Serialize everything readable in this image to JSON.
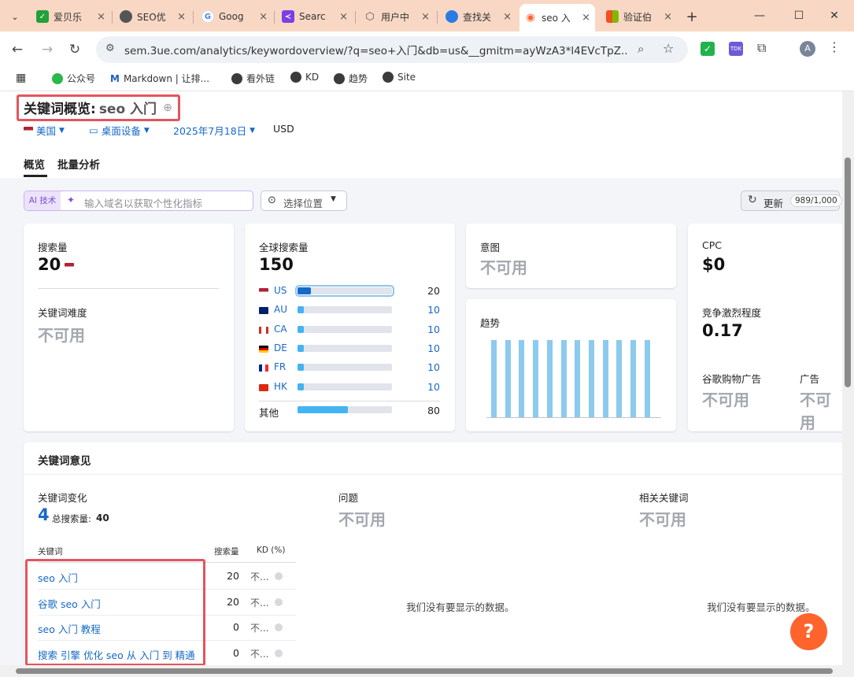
{
  "browser": {
    "tabs": [
      {
        "label": "爱贝乐",
        "icon": "check-icon",
        "color": "#22a03b"
      },
      {
        "label": "SEO优",
        "icon": "globe-icon",
        "color": "#444444"
      },
      {
        "label": "Goog",
        "icon": "google-icon",
        "color": "#4285f4"
      },
      {
        "label": "Searc",
        "icon": "search-console-icon",
        "color": "#7b3fe4"
      },
      {
        "label": "用户中",
        "icon": "box-icon",
        "color": "#555555"
      },
      {
        "label": "查找关",
        "icon": "globe-blue-icon",
        "color": "#2c7be5"
      },
      {
        "label": "seo 入",
        "icon": "semrush-icon",
        "color": "#ff642d"
      },
      {
        "label": "验证伯",
        "icon": "microsoft-icon",
        "color": "#f25022"
      }
    ],
    "new_tab": "+",
    "url": "sem.3ue.com/analytics/keywordoverview/?q=seo+入门&db=us&__gmitm=ayWzA3*l4EVcTpZ...",
    "extension_badge": "TDK",
    "profile": "A",
    "bookmarks": [
      "公众号",
      "Markdown | 让排...",
      "看外链",
      "KD",
      "趋势",
      "Site"
    ]
  },
  "header": {
    "title_prefix": "关键词概览:",
    "keyword": "seo 入门",
    "filters": {
      "country": "美国",
      "device": "桌面设备",
      "date": "2025年7月18日",
      "currency": "USD"
    },
    "tabs": [
      "概览",
      "批量分析"
    ]
  },
  "toolbar": {
    "ai_label": "AI 技术",
    "ai_placeholder": "输入域名以获取个性化指标",
    "location": "选择位置",
    "refresh": "更新",
    "quota": "989/1,000"
  },
  "cards": {
    "volume": {
      "label": "搜索量",
      "value": "20",
      "kd_label": "关键词难度",
      "kd_value": "不可用"
    },
    "global": {
      "label": "全球搜索量",
      "value": "150",
      "countries": [
        {
          "code": "US",
          "value": "20",
          "share": 0.14
        },
        {
          "code": "AU",
          "value": "10",
          "share": 0.07
        },
        {
          "code": "CA",
          "value": "10",
          "share": 0.07
        },
        {
          "code": "DE",
          "value": "10",
          "share": 0.07
        },
        {
          "code": "FR",
          "value": "10",
          "share": 0.07
        },
        {
          "code": "HK",
          "value": "10",
          "share": 0.07
        }
      ],
      "other_label": "其他",
      "other_value": "80",
      "other_share": 0.53
    },
    "intent": {
      "label": "意图",
      "value": "不可用"
    },
    "trend": {
      "label": "趋势",
      "bars": [
        1,
        1,
        1,
        1,
        1,
        1,
        1,
        1,
        1,
        1,
        1,
        1
      ]
    },
    "cpc": {
      "label": "CPC",
      "value": "$0",
      "competition_label": "竞争激烈程度",
      "competition_value": "0.17",
      "shopping_label": "谷歌购物广告",
      "shopping_value": "不可用",
      "ads_label": "广告",
      "ads_value": "不可用"
    }
  },
  "ideas": {
    "title": "关键词意见",
    "variations_label": "关键词变化",
    "variations_count": "4",
    "total_label": "总搜索量:",
    "total_value": "40",
    "questions_label": "问题",
    "questions_value": "不可用",
    "related_label": "相关关键词",
    "related_value": "不可用",
    "col_keyword": "关键词",
    "col_volume": "搜索量",
    "col_kd": "KD (%)",
    "rows": [
      {
        "keyword": "seo 入门",
        "volume": "20",
        "kd": "不..."
      },
      {
        "keyword": "谷歌 seo 入门",
        "volume": "20",
        "kd": "不..."
      },
      {
        "keyword": "seo 入门 教程",
        "volume": "0",
        "kd": "不..."
      },
      {
        "keyword": "搜索 引擎 优化 seo 从 入门 到 精通",
        "volume": "0",
        "kd": "不..."
      }
    ],
    "no_data": "我们没有要显示的数据。"
  },
  "help": "?"
}
